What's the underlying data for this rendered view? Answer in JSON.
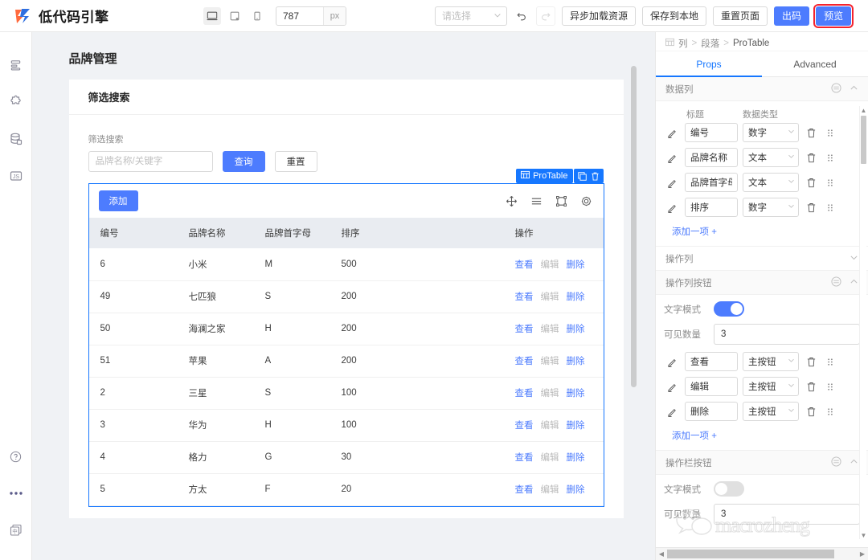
{
  "topbar": {
    "brand": "低代码引擎",
    "logo_icon": "lowcode-logo-icon",
    "devices": [
      {
        "name": "desktop-icon",
        "active": true
      },
      {
        "name": "tablet-icon",
        "active": false
      },
      {
        "name": "mobile-icon",
        "active": false
      }
    ],
    "size_value": "787",
    "size_unit": "px",
    "select_placeholder": "请选择",
    "undo_icon": "undo-icon",
    "redo_icon": "redo-icon",
    "buttons": [
      {
        "label": "异步加载资源",
        "style": "default"
      },
      {
        "label": "保存到本地",
        "style": "default"
      },
      {
        "label": "重置页面",
        "style": "default"
      },
      {
        "label": "出码",
        "style": "primary"
      },
      {
        "label": "预览",
        "style": "primary-highlight"
      }
    ]
  },
  "rail": {
    "top_items": [
      {
        "name": "outline-icon"
      },
      {
        "name": "components-puzzle-icon"
      },
      {
        "name": "datasource-icon"
      },
      {
        "name": "js-script-icon"
      }
    ],
    "bottom_items": [
      {
        "name": "help-icon"
      },
      {
        "name": "more-dots-icon"
      },
      {
        "name": "language-icon"
      }
    ]
  },
  "canvas": {
    "page_title": "品牌管理",
    "card_title": "筛选搜索",
    "filter": {
      "label": "筛选搜索",
      "placeholder": "品牌名称/关键字",
      "value": "",
      "search_button": "查询",
      "reset_button": "重置"
    },
    "selection": {
      "badge_label": "ProTable",
      "badge_icon": "table-icon",
      "copy_icon": "copy-icon",
      "delete_icon": "trash-icon"
    },
    "table_toolbar": {
      "add_button": "添加",
      "icons": [
        {
          "name": "move-icon"
        },
        {
          "name": "density-icon"
        },
        {
          "name": "fullscreen-icon"
        },
        {
          "name": "settings-gear-icon"
        }
      ]
    },
    "table": {
      "columns": [
        "编号",
        "品牌名称",
        "品牌首字母",
        "排序",
        "操作"
      ],
      "actions": [
        {
          "label": "查看",
          "muted": false
        },
        {
          "label": "编辑",
          "muted": true
        },
        {
          "label": "删除",
          "muted": false
        }
      ],
      "rows": [
        {
          "id": "6",
          "name": "小米",
          "initial": "M",
          "sort": "500"
        },
        {
          "id": "49",
          "name": "七匹狼",
          "initial": "S",
          "sort": "200"
        },
        {
          "id": "50",
          "name": "海澜之家",
          "initial": "H",
          "sort": "200"
        },
        {
          "id": "51",
          "name": "苹果",
          "initial": "A",
          "sort": "200"
        },
        {
          "id": "2",
          "name": "三星",
          "initial": "S",
          "sort": "100"
        },
        {
          "id": "3",
          "name": "华为",
          "initial": "H",
          "sort": "100"
        },
        {
          "id": "4",
          "name": "格力",
          "initial": "G",
          "sort": "30"
        },
        {
          "id": "5",
          "name": "方太",
          "initial": "F",
          "sort": "20"
        }
      ]
    }
  },
  "rpanel": {
    "breadcrumb": {
      "icon": "grid-icon",
      "items": [
        "列",
        "段落",
        "ProTable"
      ],
      "separator": ">"
    },
    "tabs": [
      {
        "label": "Props",
        "active": true
      },
      {
        "label": "Advanced",
        "active": false
      }
    ],
    "sections": [
      {
        "title": "数据列",
        "collapsed": false,
        "col_header_1": "标题",
        "col_header_2": "数据类型",
        "rows": [
          {
            "title": "编号",
            "type": "数字"
          },
          {
            "title": "品牌名称",
            "type": "文本"
          },
          {
            "title": "品牌首字母",
            "type": "文本"
          },
          {
            "title": "排序",
            "type": "数字"
          }
        ],
        "add_label": "添加一项 +"
      },
      {
        "title": "操作列",
        "collapsed": true
      },
      {
        "title": "操作列按钮",
        "collapsed": false,
        "text_mode_label": "文字模式",
        "text_mode_on": true,
        "visible_count_label": "可见数量",
        "visible_count_value": "3",
        "rows": [
          {
            "title": "查看",
            "type": "主按钮"
          },
          {
            "title": "编辑",
            "type": "主按钮"
          },
          {
            "title": "删除",
            "type": "主按钮"
          }
        ],
        "add_label": "添加一项 +"
      },
      {
        "title": "操作栏按钮",
        "collapsed": false,
        "text_mode_label": "文字模式",
        "text_mode_on": false,
        "visible_count_label": "可见数量",
        "visible_count_value": "3"
      }
    ]
  },
  "watermark": {
    "text": "macrozheng",
    "icon": "wechat-icon"
  },
  "colors": {
    "primary": "#4d7cfe",
    "selection": "#1677ff",
    "highlight": "#f5222d",
    "logo_orange": "#ff6a3d",
    "logo_blue": "#2f6fe0"
  }
}
